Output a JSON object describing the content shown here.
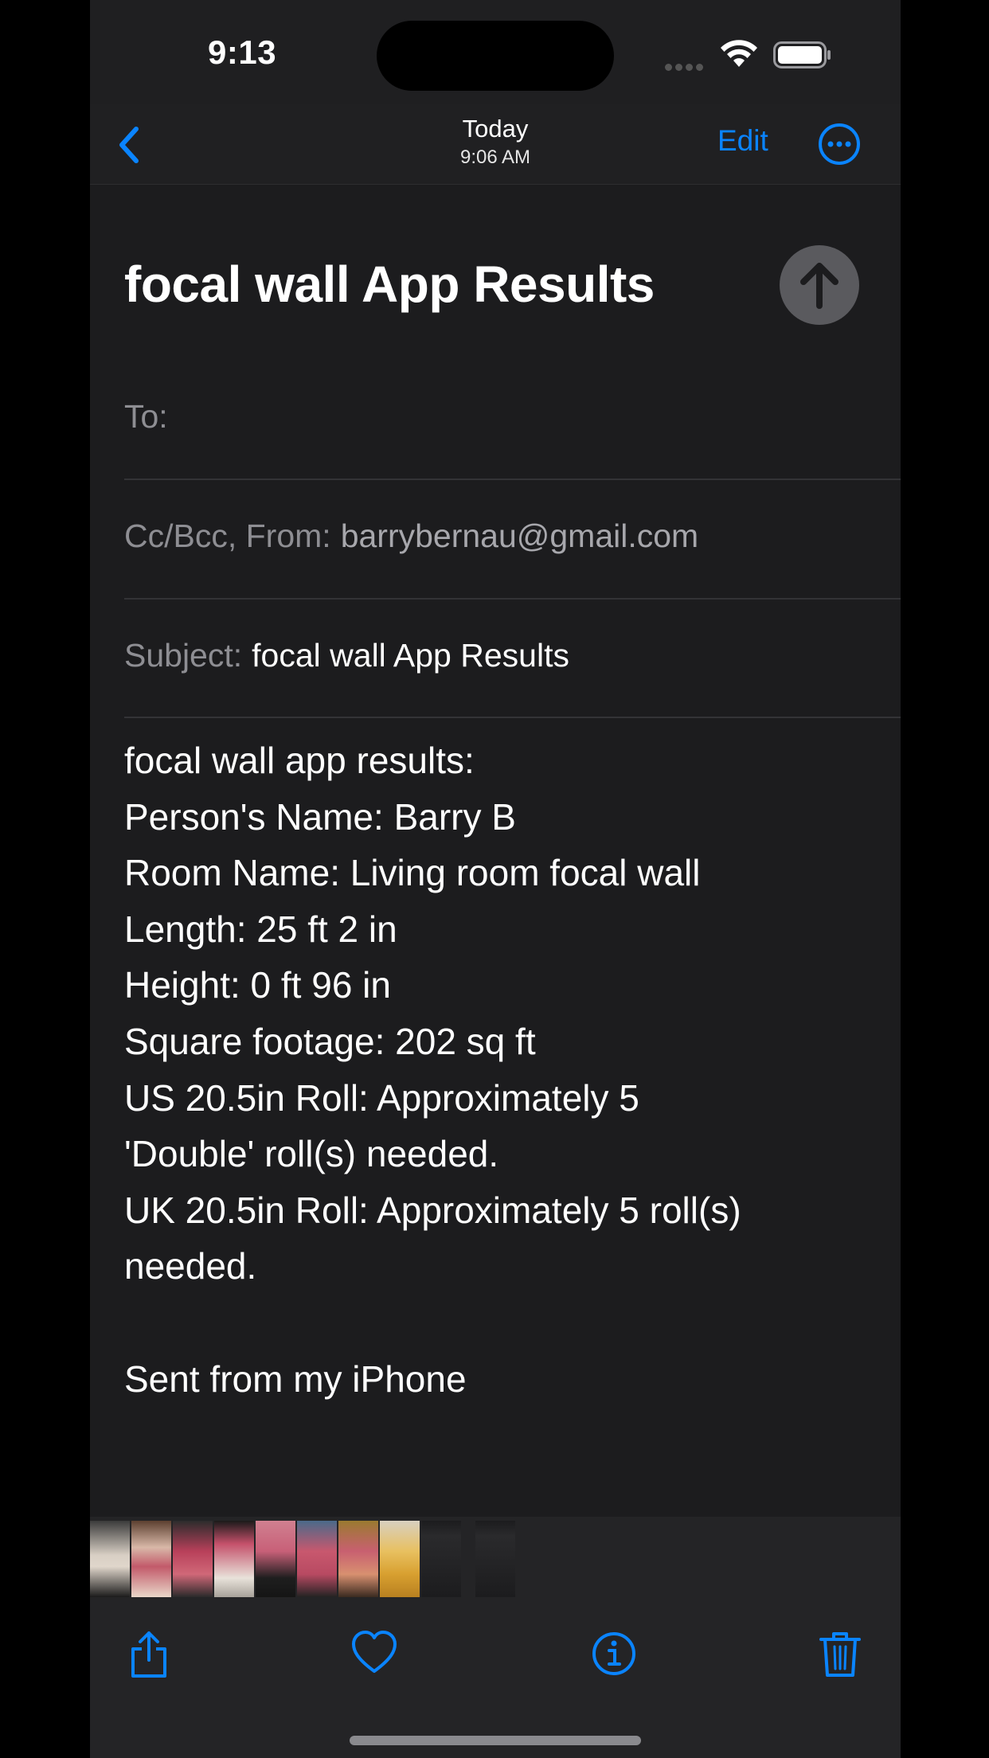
{
  "status_bar": {
    "time": "9:13"
  },
  "nav": {
    "title": "Today",
    "subtitle": "9:06 AM",
    "edit_label": "Edit",
    "back_icon": "chevron-left-icon",
    "more_icon": "ellipsis-circle-icon"
  },
  "compose": {
    "subject_heading": "focal wall App Results",
    "send_icon": "arrow-up-circle-icon",
    "to_label": "To:",
    "cc_from_label": "Cc/Bcc, From:",
    "from_value": "barrybernau@gmail.com",
    "subject_label": "Subject:",
    "subject_value": "focal wall App Results",
    "body_lines": [
      "focal wall app results:",
      "Person's Name: Barry B",
      "Room Name: Living room focal wall",
      "Length: 25 ft 2 in",
      "Height: 0 ft 96 in",
      "Square footage: 202 sq ft",
      "US 20.5in Roll: Approximately 5",
      "'Double' roll(s) needed.",
      "UK 20.5in Roll: Approximately 5 roll(s)",
      "needed.",
      "",
      "Sent from my iPhone"
    ]
  },
  "toolbar": {
    "share_icon": "share-icon",
    "favorite_icon": "heart-icon",
    "info_icon": "info-circle-icon",
    "delete_icon": "trash-icon"
  },
  "colors": {
    "accent": "#0a84ff",
    "background": "#1c1c1e",
    "secondary_text": "#8e8e93"
  }
}
